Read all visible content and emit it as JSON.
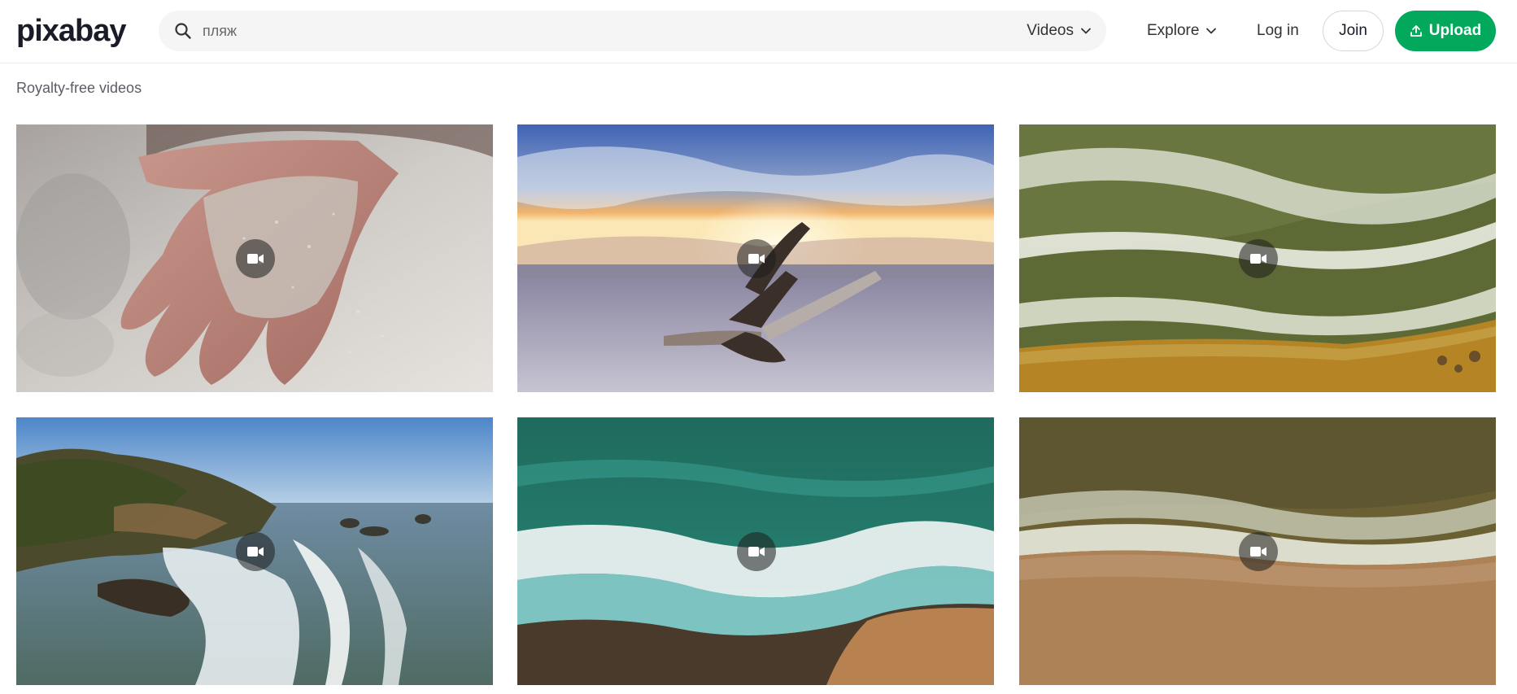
{
  "brand": {
    "name": "pixabay"
  },
  "search": {
    "value": "",
    "placeholder": "пляж",
    "type_label": "Videos"
  },
  "nav": {
    "explore_label": "Explore",
    "login_label": "Log in",
    "join_label": "Join",
    "upload_label": "Upload"
  },
  "page": {
    "subtitle": "Royalty-free videos"
  },
  "colors": {
    "accent": "#02a95c",
    "search_bg": "#f5f5f5"
  },
  "videos": [
    {
      "icon": "video-camera-icon",
      "scene": "hand-sand"
    },
    {
      "icon": "video-camera-icon",
      "scene": "sunset-driftwood"
    },
    {
      "icon": "video-camera-icon",
      "scene": "aerial-waves-green"
    },
    {
      "icon": "video-camera-icon",
      "scene": "coastline-cliffs"
    },
    {
      "icon": "video-camera-icon",
      "scene": "aerial-turquoise-wave"
    },
    {
      "icon": "video-camera-icon",
      "scene": "aerial-sand-shore"
    }
  ]
}
